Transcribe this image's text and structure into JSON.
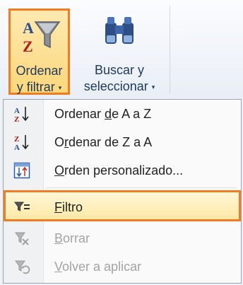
{
  "ribbon": {
    "sort_filter": {
      "line1": "Ordenar",
      "line2": "y filtrar",
      "icon": "sort-az-funnel-icon"
    },
    "find_select": {
      "line1": "Buscar y",
      "line2": "seleccionar",
      "icon": "binoculars-icon"
    },
    "dropdown_arrow": "▾"
  },
  "menu": {
    "items": [
      {
        "label": "Ordenar de A a Z",
        "icon": "sort-a-to-z-icon",
        "state": "enabled"
      },
      {
        "label": "Ordenar de Z a A",
        "icon": "sort-z-to-a-icon",
        "state": "enabled"
      },
      {
        "label": "Orden personalizado...",
        "icon": "custom-sort-icon",
        "state": "enabled"
      },
      {
        "label": "Filtro",
        "icon": "filter-icon",
        "state": "highlighted"
      },
      {
        "label": "Borrar",
        "icon": "clear-filter-icon",
        "state": "disabled"
      },
      {
        "label": "Volver a aplicar",
        "icon": "reapply-filter-icon",
        "state": "disabled"
      }
    ]
  },
  "colors": {
    "highlight_border": "#f27c22",
    "ribbon_text": "#1e395b",
    "disabled_text": "#a3a3a3"
  }
}
